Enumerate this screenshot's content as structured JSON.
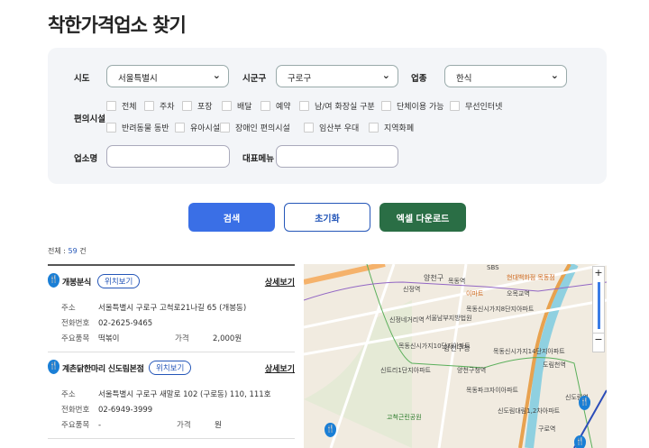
{
  "page": {
    "title": "착한가격업소 찾기"
  },
  "filters": {
    "sido_label": "시도",
    "sido_value": "서울특별시",
    "sigungu_label": "시군구",
    "sigungu_value": "구로구",
    "category_label": "업종",
    "category_value": "한식",
    "facilities_label": "편의시설",
    "facilities": [
      "전체",
      "주차",
      "포장",
      "배달",
      "예약",
      "남/여 화장실 구분",
      "단체이용 가능",
      "무선인터넷",
      "반려동물 동반",
      "유아시설",
      "장애인 편의시설",
      "임산부 우대",
      "지역화폐"
    ],
    "store_name_label": "업소명",
    "store_name_value": "",
    "menu_label": "대표메뉴",
    "menu_value": ""
  },
  "actions": {
    "search": "검색",
    "reset": "초기화",
    "excel": "엑셀 다운로드"
  },
  "colors": {
    "search": "#3a6fe6",
    "excel": "#2a6e45",
    "pin": "#1a7fd6"
  },
  "result": {
    "prefix": "전체 : ",
    "count": "59",
    "suffix": " 건"
  },
  "stores": [
    {
      "name": "개봉분식",
      "location_btn": "위치보기",
      "detail_link": "상세보기",
      "address_label": "주소",
      "address": "서울특별시 구로구 고척로21나길 65 (개봉동)",
      "phone_label": "전화번호",
      "phone": "02-2625-9465",
      "item_label": "주요품목",
      "item": "떡볶이",
      "price_label": "가격",
      "price": "2,000원"
    },
    {
      "name": "계촌닭한마리 신도림본점",
      "location_btn": "위치보기",
      "detail_link": "상세보기",
      "address_label": "주소",
      "address": "서울특별시 구로구 새말로 102 (구로동) 110, 111호",
      "phone_label": "전화번호",
      "phone": "02-6949-3999",
      "item_label": "주요품목",
      "item": "-",
      "price_label": "가격",
      "price": "원"
    }
  ],
  "map": {
    "labels": [
      "양천구",
      "목동역",
      "신정역",
      "오목교역",
      "신정네거리역",
      "서울남부지방법원",
      "목동신시가지8단지아파트",
      "목동신시가지10단지아파트",
      "양천구청",
      "목동신시가지14단지아파트",
      "신트리1단지아파트",
      "양천구청역",
      "도림천역",
      "목동파크자이아파트",
      "고척근린공원",
      "신도림대림1,2차아파트",
      "구로역",
      "신도림역",
      "현대백화점 목동점",
      "이마트",
      "SBS"
    ],
    "zoom_in": "+",
    "zoom_out": "−"
  }
}
